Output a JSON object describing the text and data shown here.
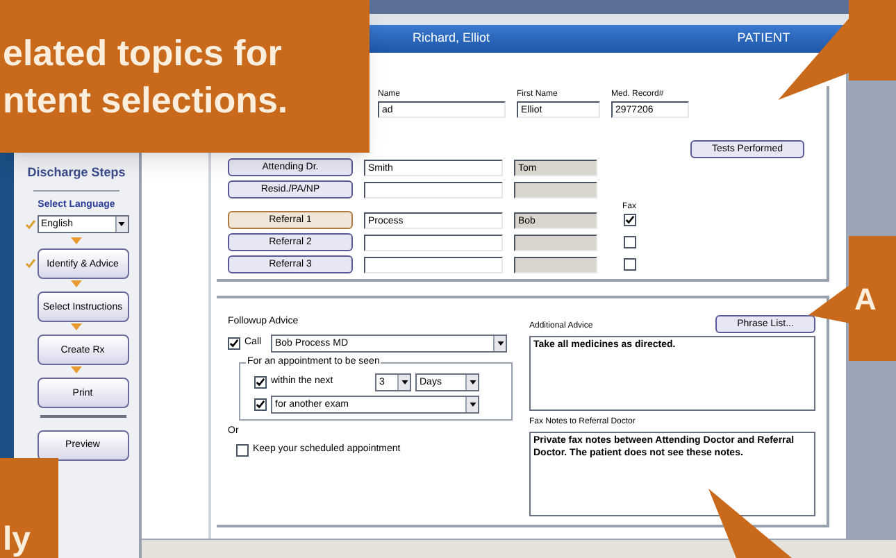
{
  "header": {
    "patient_name": "Richard, Elliot",
    "section": "PATIENT"
  },
  "sidebar": {
    "title": "Discharge Steps",
    "language_label": "Select Language",
    "language": {
      "value": "English",
      "done": true
    },
    "steps": [
      {
        "label": "Identify & Advice",
        "done": true
      },
      {
        "label": "Select Instructions",
        "done": false
      },
      {
        "label": "Create Rx",
        "done": false
      },
      {
        "label": "Print",
        "done": false
      }
    ],
    "preview": "Preview"
  },
  "patient": {
    "last_name_label": "Name",
    "last_name": "ad",
    "first_name_label": "First Name",
    "first_name": "Elliot",
    "record_label": "Med. Record#",
    "record": "2977206",
    "tests_button": "Tests Performed"
  },
  "fax_label": "Fax",
  "doctors": [
    {
      "role": "Attending Dr.",
      "last": "Smith",
      "first": "Tom",
      "highlighted": false
    },
    {
      "role": "Resid./PA/NP",
      "highlighted": false
    },
    {
      "role": "Referral 1",
      "last": "Process",
      "first": "Bob",
      "fax": true,
      "highlighted": true
    },
    {
      "role": "Referral 2",
      "fax": false,
      "highlighted": false
    },
    {
      "role": "Referral 3",
      "fax": false,
      "highlighted": false
    }
  ],
  "followup": {
    "title": "Followup Advice",
    "call": {
      "label": "Call",
      "checked": true,
      "doctor": "Bob Process MD"
    },
    "group_label": "For an appointment to be seen",
    "within": {
      "label": "within the next",
      "checked": true,
      "count": "3",
      "unit": "Days"
    },
    "reason": {
      "checked": true,
      "value": "for another exam"
    },
    "or_label": "Or",
    "keep": {
      "label": "Keep your scheduled appointment",
      "checked": false
    }
  },
  "additional": {
    "label": "Additional Advice",
    "button": "Phrase List...",
    "text": "Take all medicines as directed."
  },
  "fax_notes": {
    "label": "Fax Notes to Referral Doctor",
    "text": "Private fax notes between Attending Doctor and Referral Doctor.  The patient does not see these notes."
  },
  "callouts": [
    {
      "lines": [
        "elated topics for",
        "ntent selections."
      ]
    },
    {
      "lines": [
        "A"
      ]
    },
    {
      "lines": [
        "ly"
      ]
    }
  ]
}
